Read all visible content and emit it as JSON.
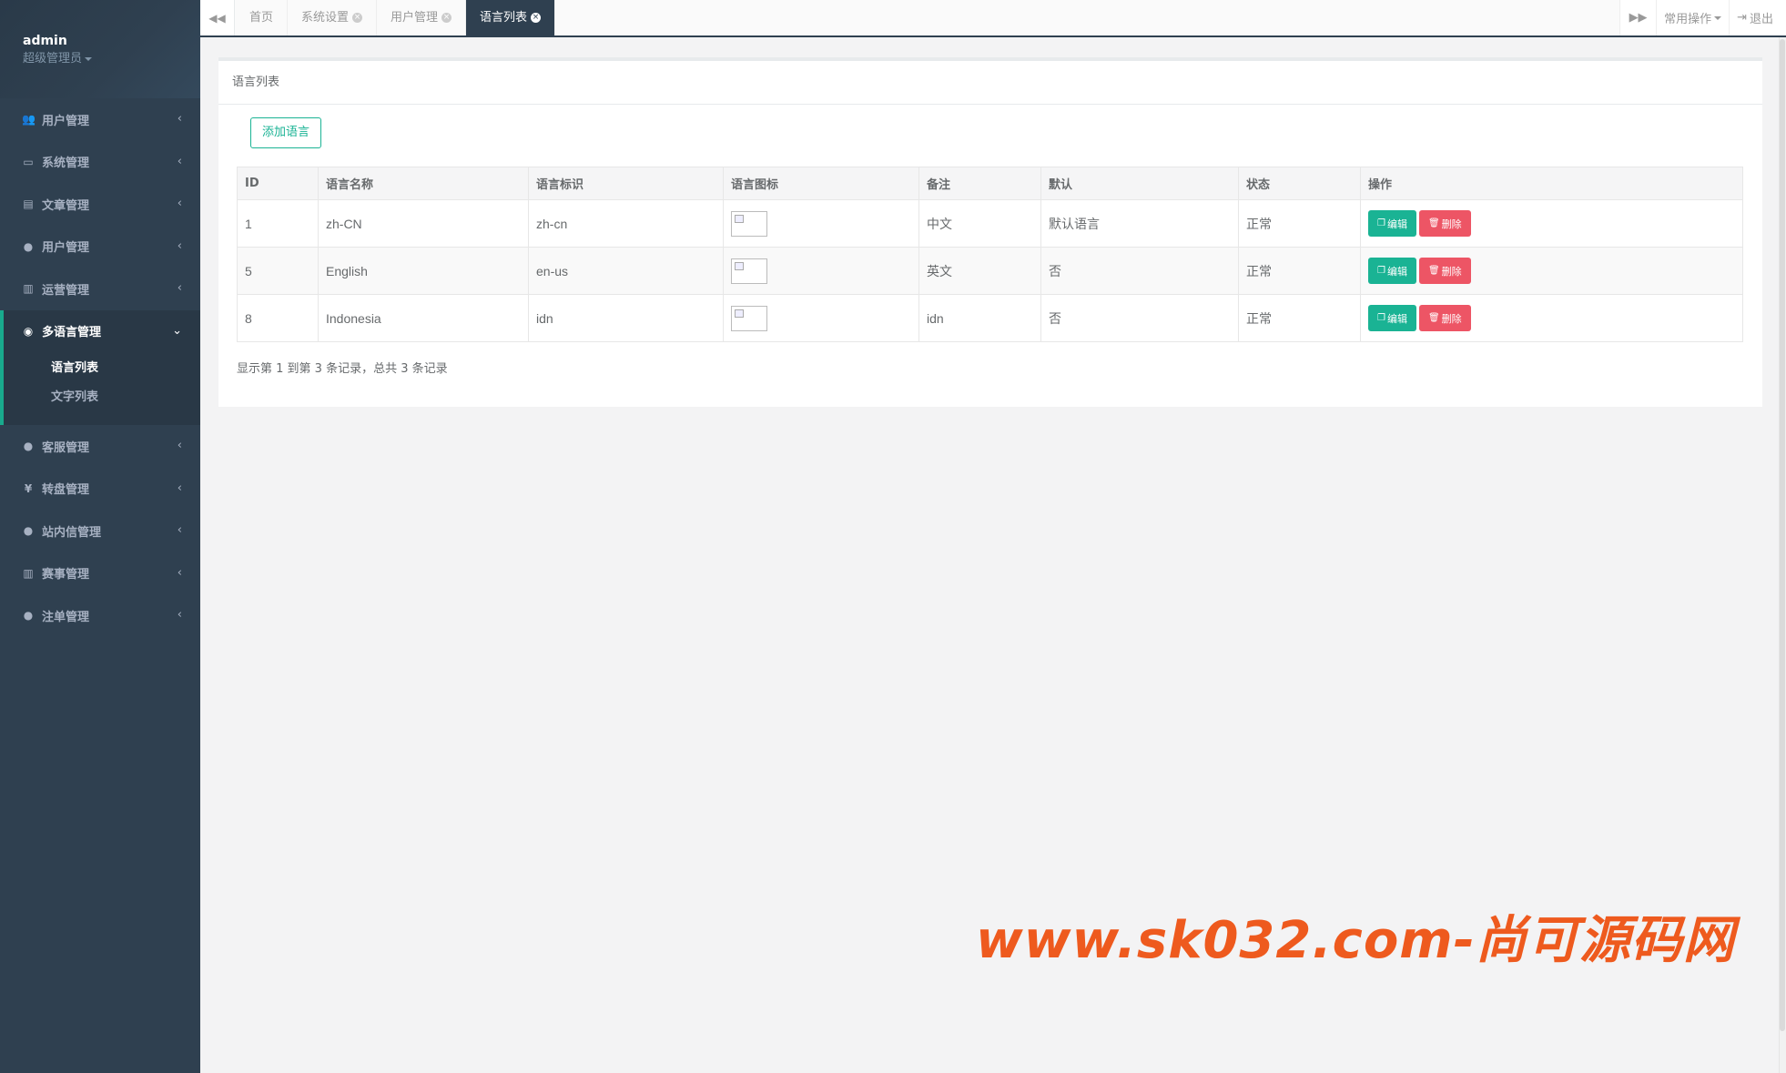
{
  "sidebar": {
    "user": {
      "name": "admin",
      "role": "超级管理员"
    },
    "menu": [
      {
        "label": "用户管理",
        "icon": "users-icon"
      },
      {
        "label": "系统管理",
        "icon": "desktop-icon"
      },
      {
        "label": "文章管理",
        "icon": "book-icon"
      },
      {
        "label": "用户管理",
        "icon": "user-icon"
      },
      {
        "label": "运营管理",
        "icon": "bar-chart-icon"
      },
      {
        "label": "多语言管理",
        "icon": "globe-icon",
        "active": true,
        "children": [
          {
            "label": "语言列表",
            "active": true
          },
          {
            "label": "文字列表"
          }
        ]
      },
      {
        "label": "客服管理",
        "icon": "comment-icon"
      },
      {
        "label": "转盘管理",
        "icon": "yen-icon"
      },
      {
        "label": "站内信管理",
        "icon": "comment-icon"
      },
      {
        "label": "赛事管理",
        "icon": "bar-chart-icon"
      },
      {
        "label": "注单管理",
        "icon": "user-icon"
      }
    ]
  },
  "tabbar": {
    "tabs": [
      "首页",
      "系统设置",
      "用户管理",
      "语言列表"
    ],
    "common_ops": "常用操作",
    "logout": "退出"
  },
  "panel": {
    "title": "语言列表",
    "add_button": "添加语言",
    "columns": [
      "ID",
      "语言名称",
      "语言标识",
      "语言图标",
      "备注",
      "默认",
      "状态",
      "操作"
    ],
    "rows": [
      {
        "id": "1",
        "name": "zh-CN",
        "code": "zh-cn",
        "note": "中文",
        "default": "默认语言",
        "status": "正常"
      },
      {
        "id": "5",
        "name": "English",
        "code": "en-us",
        "note": "英文",
        "default": "否",
        "status": "正常"
      },
      {
        "id": "8",
        "name": "Indonesia",
        "code": "idn",
        "note": "idn",
        "default": "否",
        "status": "正常"
      }
    ],
    "edit_label": "编辑",
    "delete_label": "删除",
    "pagination_info": "显示第 1 到第 3 条记录，总共 3 条记录"
  },
  "watermark": "www.sk032.com-尚可源码网",
  "colors": {
    "sidebar": "#2f4050",
    "accent": "#1ab394",
    "danger": "#ed5565",
    "watermark": "#ee5a1e"
  }
}
